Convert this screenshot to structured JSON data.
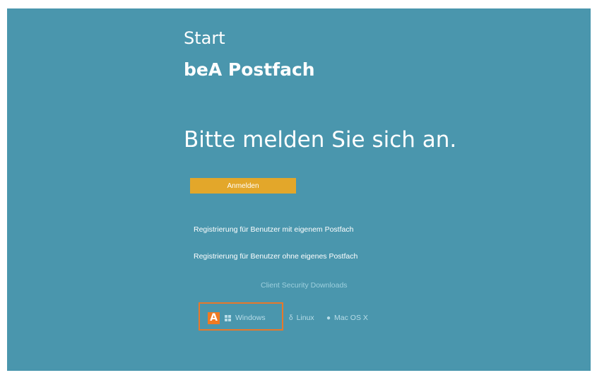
{
  "header": {
    "start_label": "Start",
    "app_title": "beA Postfach"
  },
  "main": {
    "prompt": "Bitte melden Sie sich an.",
    "login_button": "Anmelden",
    "register_with_mailbox": "Registrierung für Benutzer mit eigenem Postfach",
    "register_without_mailbox": "Registrierung für Benutzer ohne eigenes Postfach"
  },
  "downloads": {
    "heading": "Client Security Downloads",
    "badge": "A",
    "windows": "Windows",
    "linux": "Linux",
    "mac": "Mac OS X"
  },
  "colors": {
    "background": "#4a96ad",
    "button": "#e3a72a",
    "highlight": "#e8782a"
  },
  "icons": {
    "windows": "windows-icon",
    "linux": "linux-icon",
    "mac": "apple-icon"
  }
}
